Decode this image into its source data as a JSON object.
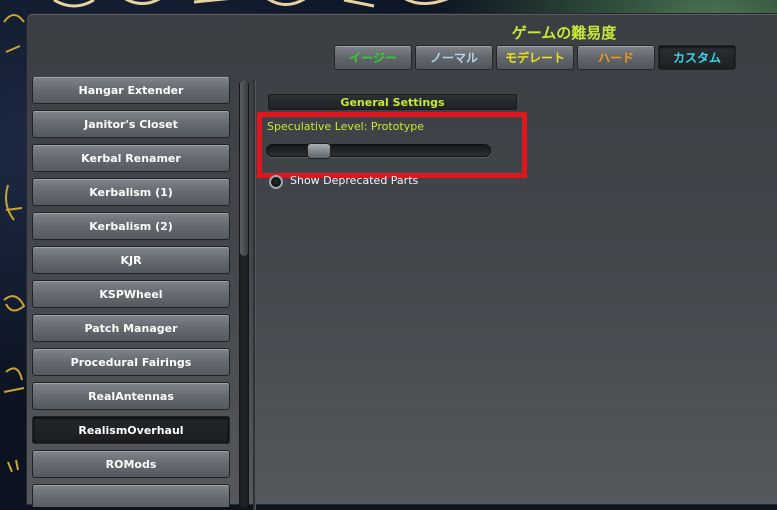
{
  "window": {
    "title": "ゲームの難易度"
  },
  "difficulty_tabs": [
    {
      "label": "イージー",
      "color": "#2fd22f",
      "active": false
    },
    {
      "label": "ノーマル",
      "color": "#b6d7e6",
      "active": false
    },
    {
      "label": "モデレート",
      "color": "#f0e21a",
      "active": false
    },
    {
      "label": "ハード",
      "color": "#f59a10",
      "active": false
    },
    {
      "label": "カスタム",
      "color": "#39d7e7",
      "active": true
    }
  ],
  "mod_list": {
    "items": [
      {
        "label": "Hangar Extender",
        "selected": false
      },
      {
        "label": "Janitor's Closet",
        "selected": false
      },
      {
        "label": "Kerbal Renamer",
        "selected": false
      },
      {
        "label": "Kerbalism (1)",
        "selected": false
      },
      {
        "label": "Kerbalism (2)",
        "selected": false
      },
      {
        "label": "KJR",
        "selected": false
      },
      {
        "label": "KSPWheel",
        "selected": false
      },
      {
        "label": "Patch Manager",
        "selected": false
      },
      {
        "label": "Procedural Fairings",
        "selected": false
      },
      {
        "label": "RealAntennas",
        "selected": false
      },
      {
        "label": "RealismOverhaul",
        "selected": true
      },
      {
        "label": "ROMods",
        "selected": false
      }
    ]
  },
  "settings": {
    "section_title": "General Settings",
    "speculative_level_label": "Speculative Level: Prototype",
    "speculative_level_slider_value": 0.23,
    "show_deprecated_label": "Show Deprecated Parts",
    "show_deprecated_checked": false
  },
  "colors": {
    "accent_yellow_green": "#c8e835",
    "highlight_red": "#e0151d"
  }
}
